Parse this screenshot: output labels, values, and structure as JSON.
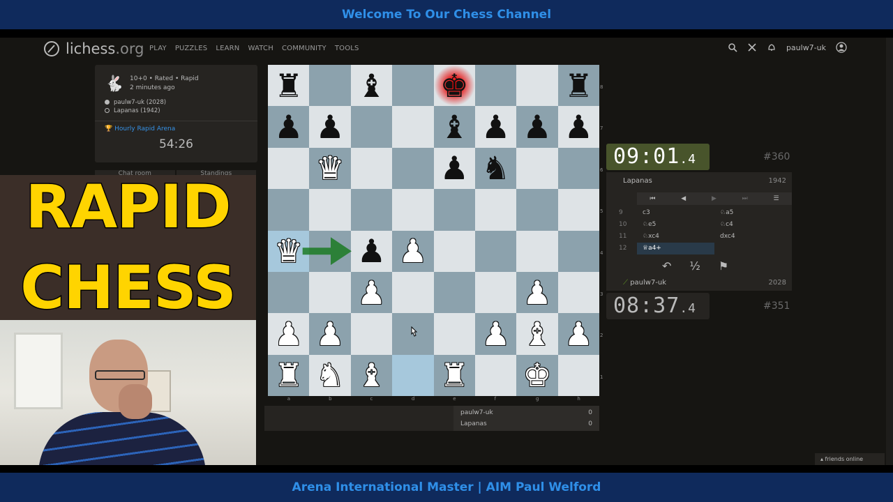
{
  "banner_top": "Welcome To Our Chess Channel",
  "banner_bottom": "Arena International Master | AIM Paul Welford",
  "site": {
    "logo_main": "lichess",
    "logo_suffix": ".org"
  },
  "nav": [
    "PLAY",
    "PUZZLES",
    "LEARN",
    "WATCH",
    "COMMUNITY",
    "TOOLS"
  ],
  "user": {
    "name": "paulw7-uk"
  },
  "game_info": {
    "line1": "10+0 • Rated • Rapid",
    "line2": "2 minutes ago",
    "white": "paulw7-uk (2028)",
    "black": "Lapanas (1942)",
    "arena": "Hourly Rapid Arena",
    "arena_timer": "54:26"
  },
  "chat_tabs": [
    "Chat room",
    "Standings"
  ],
  "thumb": {
    "line1": "RAPID",
    "line2": "CHESS"
  },
  "board": {
    "rows": [
      [
        "bR",
        "",
        "bB",
        "",
        "bK",
        "",
        "",
        "bR"
      ],
      [
        "bP",
        "bP",
        "",
        "",
        "bB",
        "bP",
        "bP",
        "bP"
      ],
      [
        "",
        "wQ_b",
        "",
        "",
        "bP",
        "bN",
        "",
        ""
      ],
      [
        "",
        "",
        "",
        "",
        "",
        "",
        "",
        ""
      ],
      [
        "wQ",
        "",
        "bP",
        "wP",
        "",
        "",
        "",
        ""
      ],
      [
        "",
        "",
        "wP",
        "",
        "",
        "",
        "wP",
        ""
      ],
      [
        "wP",
        "wP",
        "",
        "",
        "",
        "wP",
        "wB",
        "wP"
      ],
      [
        "wR",
        "wN",
        "wB",
        "",
        "wR",
        "",
        "wK",
        ""
      ]
    ],
    "files": [
      "a",
      "b",
      "c",
      "d",
      "e",
      "f",
      "g",
      "h"
    ],
    "ranks": [
      "8",
      "7",
      "6",
      "5",
      "4",
      "3",
      "2",
      "1"
    ],
    "check_square": "e8",
    "lastmove": [
      "a4",
      "d1"
    ],
    "arrow": {
      "from": "a4",
      "to": "c4",
      "color": "#15781b"
    }
  },
  "crosstable": [
    {
      "name": "paulw7-uk",
      "score": "0"
    },
    {
      "name": "Lapanas",
      "score": "0"
    }
  ],
  "clock_top": {
    "main": "09:01",
    "tenths": ".4",
    "rank": "#360"
  },
  "clock_bottom": {
    "main": "08:37",
    "tenths": ".4",
    "rank": "#351"
  },
  "opponent": {
    "name": "Lapanas",
    "rating": "1942"
  },
  "player": {
    "name": "paulw7-uk",
    "rating": "2028"
  },
  "moves": [
    {
      "num": "9",
      "white": "c3",
      "black": "♘a5"
    },
    {
      "num": "10",
      "white": "♘e5",
      "black": "♘c4"
    },
    {
      "num": "11",
      "white": "♘xc4",
      "black": "dxc4"
    },
    {
      "num": "12",
      "white": "♕a4+",
      "black": ""
    }
  ],
  "actions": {
    "takeback": "↶",
    "draw": "½",
    "resign": "⚑"
  },
  "friends": "▴ friends online",
  "colors": {
    "board_light": "#dee3e6",
    "board_dark": "#8ca2ad",
    "arrow": "#15781b",
    "clock_active": "#48542b"
  }
}
